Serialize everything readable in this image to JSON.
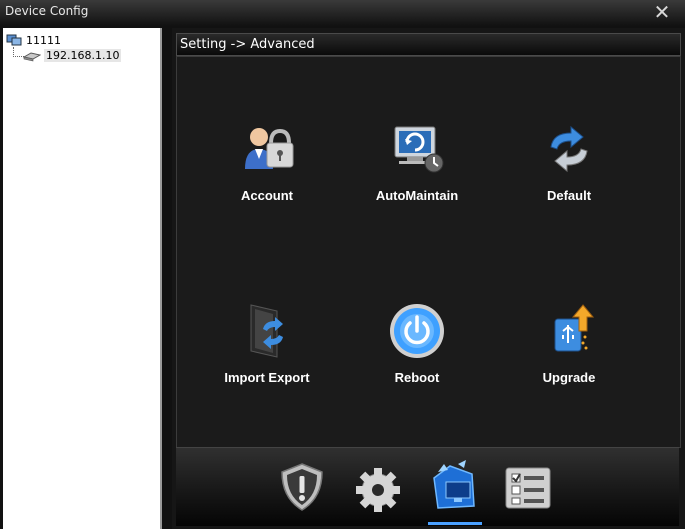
{
  "window": {
    "title": "Device Config",
    "close_glyph": "✕"
  },
  "tree": {
    "root": {
      "label": "11111",
      "icon": "device-group-icon"
    },
    "child": {
      "label": "192.168.1.10",
      "icon": "network-device-icon"
    }
  },
  "breadcrumb": "Setting -> Advanced",
  "tiles": [
    {
      "label": "Account",
      "icon": "user-lock-icon"
    },
    {
      "label": "AutoMaintain",
      "icon": "monitor-clock-icon"
    },
    {
      "label": "Default",
      "icon": "refresh-arrows-icon"
    },
    {
      "label": "Import Export",
      "icon": "door-arrows-icon"
    },
    {
      "label": "Reboot",
      "icon": "power-icon"
    },
    {
      "label": "Upgrade",
      "icon": "usb-upgrade-icon"
    }
  ],
  "bottom_nav": [
    {
      "name": "alarm",
      "icon": "shield-alert-icon"
    },
    {
      "name": "system",
      "icon": "gear-icon"
    },
    {
      "name": "advanced",
      "icon": "advanced-tools-icon",
      "active": true
    },
    {
      "name": "info",
      "icon": "checklist-icon"
    }
  ],
  "colors": {
    "accent": "#4aa0ff",
    "panel": "#1b1b1b",
    "text": "#ffffff"
  }
}
